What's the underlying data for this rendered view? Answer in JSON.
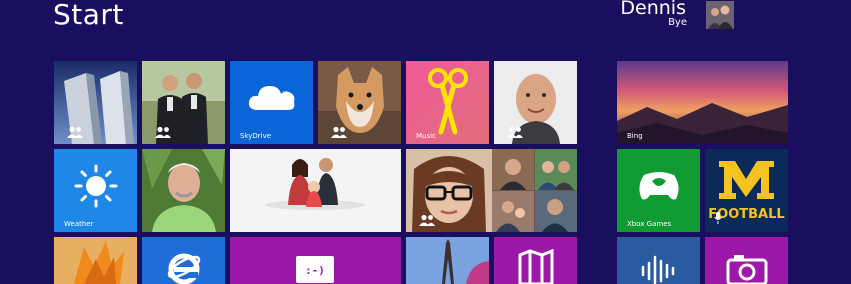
{
  "header": {
    "title": "Start"
  },
  "user": {
    "name": "Dennis",
    "status": "Bye"
  },
  "tiles": {
    "skydrive": {
      "label": "SkyDrive"
    },
    "music": {
      "label": "Music"
    },
    "weather": {
      "label": "Weather"
    },
    "bing": {
      "label": "Bing"
    },
    "xbox": {
      "label": "Xbox Games"
    }
  },
  "colors": {
    "background": "#1a0f5e",
    "skydrive": "#0a66d8",
    "music": "#ed5d96",
    "weather": "#1f87e8",
    "xbox": "#109a34",
    "messaging": "#9b18a8",
    "football": "#0b2a5a"
  }
}
